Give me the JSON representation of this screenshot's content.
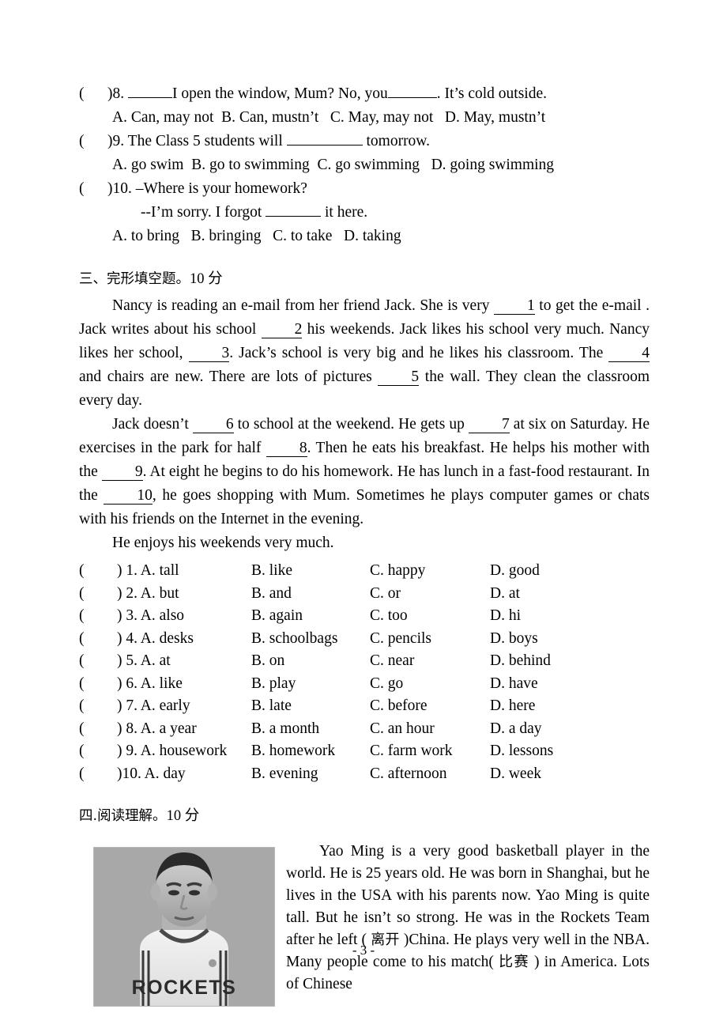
{
  "page": {
    "page_number_label": "- 3 -"
  },
  "mcq_tail": {
    "q8": {
      "marker": "(",
      "paren_close": ")8.",
      "stem_before": "I open the window, Mum? No, you",
      "stem_after": ". It’s cold outside.",
      "options": "A. Can, may not  B. Can, mustn’t   C. May, may not   D. May, mustn’t"
    },
    "q9": {
      "marker": "(",
      "paren_close": ")9.",
      "stem_before": "The Class 5 students will ",
      "stem_after": " tomorrow.",
      "options": "A. go swim  B. go to swimming  C. go swimming   D. going swimming"
    },
    "q10": {
      "marker": "(",
      "paren_close": ")10.",
      "stem_line1": "–Where is your homework?",
      "stem_line2_before": "--I’m sorry. I forgot ",
      "stem_line2_after": " it here.",
      "options": "A. to bring   B. bringing   C. to take   D. taking"
    }
  },
  "cloze": {
    "heading_cn": "三、完形填空题。",
    "heading_score": "10 分",
    "para1": {
      "t1": "Nancy is reading an e-mail from her friend Jack. She is very ",
      "blank1": "1",
      "t2": " to get the e-mail . Jack writes about his school ",
      "blank2": "2",
      "t3": " his weekends. Jack likes his school very much. Nancy likes her school, ",
      "blank3": "3",
      "t4": ". Jack’s school is very big and he likes his classroom. The ",
      "blank4": "4",
      "t5": " and chairs are new. There are lots of pictures ",
      "blank5": "5",
      "t6": " the wall. They clean the classroom every day."
    },
    "para2": {
      "t1": "Jack doesn’t ",
      "blank6": "6",
      "t2": " to school at the weekend. He gets up ",
      "blank7": "7",
      "t3": " at six on Saturday. He exercises in the park for half ",
      "blank8": "8",
      "t4": ". Then he eats his breakfast. He helps his mother with the ",
      "blank9": "9",
      "t5": ". At eight he begins to do his homework. He has lunch in a fast-food restaurant. In the ",
      "blank10": "10",
      "t6": ", he goes shopping with Mum. Sometimes he plays computer games or chats with his friends on the Internet in the evening."
    },
    "para3": "He enjoys his weekends very much.",
    "answer_rows": [
      {
        "paren": "(",
        "a": ") 1. A. tall",
        "b": "B. like",
        "c": "C. happy",
        "d": "D. good"
      },
      {
        "paren": "(",
        "a": ") 2. A. but",
        "b": "B. and",
        "c": "C. or",
        "d": "D. at"
      },
      {
        "paren": "(",
        "a": ") 3. A. also",
        "b": "B. again",
        "c": "C. too",
        "d": "D. hi"
      },
      {
        "paren": "(",
        "a": ") 4. A. desks",
        "b": "B. schoolbags",
        "c": "C. pencils",
        "d": "D. boys"
      },
      {
        "paren": "(",
        "a": ") 5. A. at",
        "b": "B. on",
        "c": "C. near",
        "d": "D. behind"
      },
      {
        "paren": "(",
        "a": ") 6. A. like",
        "b": "B. play",
        "c": "C. go",
        "d": "D. have"
      },
      {
        "paren": "(",
        "a": ") 7. A. early",
        "b": "B. late",
        "c": "C. before",
        "d": "D. here"
      },
      {
        "paren": "(",
        "a": ") 8. A. a year",
        "b": "B. a month",
        "c": "C. an hour",
        "d": "D. a day"
      },
      {
        "paren": "(",
        "a": ") 9. A. housework",
        "b": "B. homework",
        "c": "C. farm work",
        "d": "D. lessons"
      },
      {
        "paren": "(",
        "a": ")10. A. day",
        "b": "B. evening",
        "c": "C. afternoon",
        "d": "D. week"
      }
    ]
  },
  "reading": {
    "heading_cn": "四.阅读理解。",
    "heading_score": "10 分",
    "photo_alt": "yao-ming-rockets-photo",
    "photo_jersey_text": "ROCKETS",
    "passage_part1": "Yao Ming is a very good basketball player in the world. He is 25 years old. He was born in Shanghai, but he lives in the USA with his parents now. Yao Ming is quite tall. But he isn’t so strong. He was in the Rockets Team after he left ( ",
    "gloss1": "离开",
    "passage_part2": " )China. He plays very well in the NBA. Many people come to his match(  ",
    "gloss2": "比赛",
    "passage_part3": " ) in America. Lots of Chinese"
  }
}
